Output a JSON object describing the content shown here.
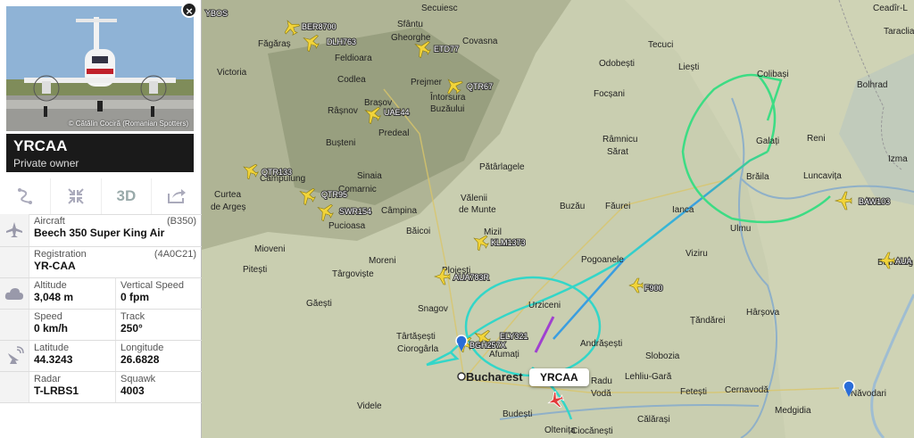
{
  "panel": {
    "close_label": "×",
    "photo_credit": "© Cătălin Cociră (Romanian Spotters)",
    "callsign": "YRCAA",
    "owner": "Private owner",
    "tools": {
      "route": "route-icon",
      "center": "center-icon",
      "view3d": "3D",
      "share": "share-icon"
    },
    "aircraft": {
      "label": "Aircraft",
      "code": "(B350)",
      "value": "Beech 350 Super King Air"
    },
    "registration": {
      "label": "Registration",
      "code": "(4A0C21)",
      "value": "YR-CAA"
    },
    "altitude": {
      "label": "Altitude",
      "value": "3,048 m"
    },
    "vspeed": {
      "label": "Vertical Speed",
      "value": "0 fpm"
    },
    "speed": {
      "label": "Speed",
      "value": "0 km/h"
    },
    "track": {
      "label": "Track",
      "value": "250°"
    },
    "latitude": {
      "label": "Latitude",
      "value": "44.3243"
    },
    "longitude": {
      "label": "Longitude",
      "value": "26.6828"
    },
    "radar": {
      "label": "Radar",
      "value": "T-LRBS1"
    },
    "squawk": {
      "label": "Squawk",
      "value": "4003"
    }
  },
  "map": {
    "selected_tag": "YRCAA",
    "colors": {
      "track_green": "#3ddc84",
      "track_blue": "#3a9ee0",
      "track_cyan": "#33d6c8",
      "plane_yellow": "#f2d43a"
    },
    "places": [
      "Secuiesc",
      "Ceadîr-L",
      "Sfântu",
      "Gheorghe",
      "Covasna",
      "Tecuci",
      "Taraclia",
      "Făgăraș",
      "Feldioara",
      "Odobești",
      "Liești",
      "Colibași",
      "Victoria",
      "Codlea",
      "Prejmer",
      "Focșani",
      "Bolhrad",
      "Râșnov",
      "Brașov",
      "Întorsura",
      "Buzăului",
      "Predeal",
      "Râmnicu",
      "Sărat",
      "Galați",
      "Reni",
      "Bușteni",
      "Sinaia",
      "Pătârlagele",
      "Brăila",
      "Luncavița",
      "Izma",
      "Câmpulung",
      "Comarnic",
      "Vălenii",
      "de Munte",
      "Curtea",
      "de Argeș",
      "Câmpina",
      "Buzău",
      "Făurei",
      "Ianca",
      "Pucioasa",
      "Băicoi",
      "Mizil",
      "Ulmu",
      "Mioveni",
      "Ploiești",
      "Pogoanele",
      "Viziru",
      "Pitești",
      "Târgoviște",
      "Moreni",
      "Urziceni",
      "Găești",
      "Snagov",
      "Țăndărei",
      "Hârșova",
      "Târtășești",
      "Ciorogârla",
      "Afumați",
      "Andrășești",
      "Slobozia",
      "Bucharest",
      "Radu",
      "Vodă",
      "Budești",
      "Fetești",
      "Cernavodă",
      "Medgidia",
      "Năvodari",
      "Videle",
      "Oltenița",
      "Călărași",
      "Ciocănești",
      "Lehliu-Gară",
      "Babadag"
    ],
    "flights": [
      "YBOS",
      "BER8700",
      "DLH763",
      "ETD77",
      "QTR67",
      "UAE44",
      "QTR133",
      "QTR95",
      "SWR154",
      "KLM1373",
      "AUA783R",
      "F900",
      "BAW103",
      "AUA",
      "ELY321",
      "BGH257X"
    ]
  }
}
